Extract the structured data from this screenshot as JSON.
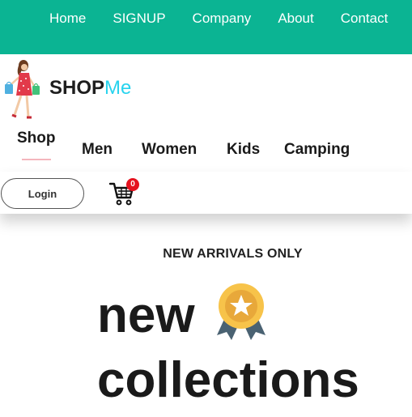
{
  "topnav": {
    "links": [
      "Home",
      "SIGNUP",
      "Company",
      "About",
      "Contact"
    ]
  },
  "brand": {
    "shop": "SHOP",
    "me": "Me"
  },
  "categories": {
    "shop": "Shop",
    "men": "Men",
    "women": "Women",
    "kids": "Kids",
    "camping": "Camping"
  },
  "actions": {
    "login_label": "Login",
    "cart_count": "0"
  },
  "hero": {
    "kicker": "NEW ARRIVALS ONLY",
    "line1": "new",
    "line2": "collections"
  },
  "colors": {
    "topbar": "#0bb493",
    "brand_accent": "#27d3ee",
    "badge": "#e5121e"
  },
  "icons": {
    "logo": "shopping-woman-icon",
    "cart": "shopping-cart-icon",
    "medal": "medal-icon"
  }
}
